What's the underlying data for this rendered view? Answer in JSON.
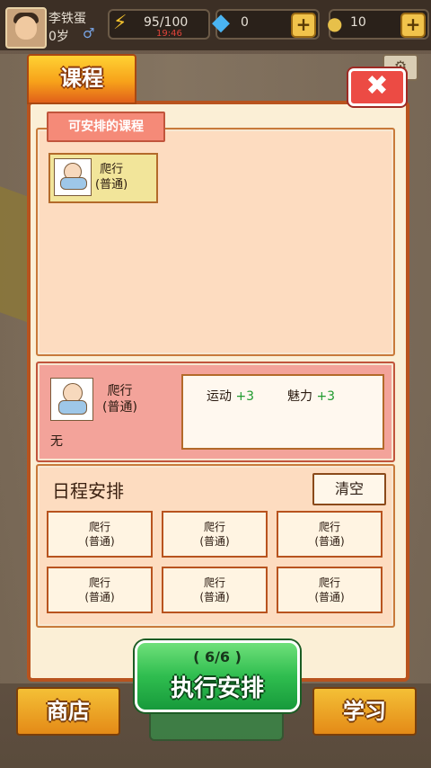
{
  "hud": {
    "player_name": "李铁蛋",
    "player_age": "0岁",
    "gender_icon": "♂",
    "energy": "95/100",
    "energy_timer": "19:46",
    "gems": "0",
    "coins": "10"
  },
  "modal": {
    "title": "课程",
    "close_label": "✖",
    "available_label": "可安排的课程",
    "available_courses": [
      {
        "name": "爬行",
        "level": "(普通)"
      }
    ],
    "selected": {
      "name": "爬行",
      "level": "(普通)",
      "note": "无",
      "stats": [
        {
          "label": "运动",
          "value": "+3"
        },
        {
          "label": "魅力",
          "value": "+3"
        }
      ]
    },
    "schedule_title": "日程安排",
    "clear_label": "清空",
    "slots": [
      {
        "name": "爬行",
        "level": "(普通)"
      },
      {
        "name": "爬行",
        "level": "(普通)"
      },
      {
        "name": "爬行",
        "level": "(普通)"
      },
      {
        "name": "爬行",
        "level": "(普通)"
      },
      {
        "name": "爬行",
        "level": "(普通)"
      },
      {
        "name": "爬行",
        "level": "(普通)"
      }
    ],
    "execute_count": "( 6/6 )",
    "execute_label": "执行安排"
  },
  "bottom": {
    "shop_label": "商店",
    "study_label": "学习"
  }
}
